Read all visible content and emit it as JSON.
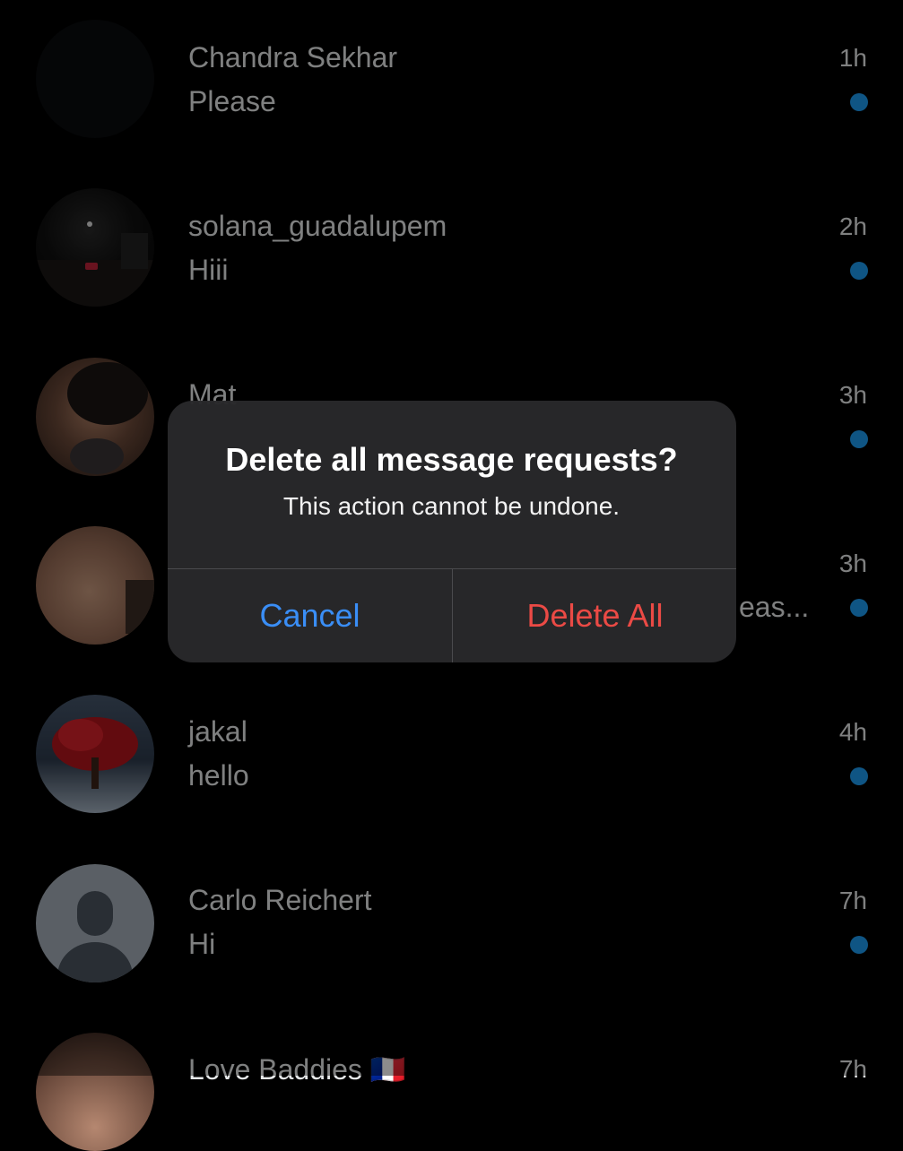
{
  "accent_colors": {
    "unread_dot": "#1d9bf0",
    "cancel": "#3a8ef6",
    "destructive": "#eb4a45"
  },
  "conversations": [
    {
      "name": "Chandra Sekhar",
      "preview": "Please",
      "time": "1h",
      "unread": true,
      "avatar": "dark-circle"
    },
    {
      "name": "solana_guadalupem",
      "preview": "Hiii",
      "time": "2h",
      "unread": true,
      "avatar": "night-street-photo"
    },
    {
      "name": "Mat",
      "preview": "",
      "time": "3h",
      "unread": true,
      "avatar": "person-photo"
    },
    {
      "name": "",
      "preview": "eas...",
      "time": "3h",
      "unread": true,
      "avatar": "skin-photo"
    },
    {
      "name": "jakal",
      "preview": "hello",
      "time": "4h",
      "unread": true,
      "avatar": "red-tree-photo"
    },
    {
      "name": "Carlo Reichert",
      "preview": "Hi",
      "time": "7h",
      "unread": true,
      "avatar": "default-user-icon"
    },
    {
      "name": "Love Baddies 🇫🇷",
      "preview": "",
      "time": "7h",
      "unread": true,
      "avatar": "person-photo"
    }
  ],
  "dialog": {
    "title": "Delete all message requests?",
    "message": "This action cannot be undone.",
    "cancel_label": "Cancel",
    "confirm_label": "Delete All"
  }
}
